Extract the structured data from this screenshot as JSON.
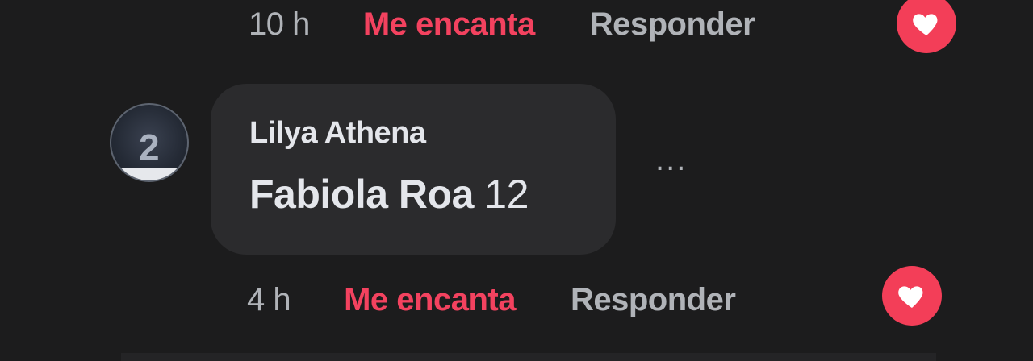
{
  "top_comment": {
    "time": "10 h",
    "love_label": "Me encanta",
    "reply_label": "Responder",
    "reaction_icon": "heart-icon"
  },
  "reply_comment": {
    "author": "Lilya Athena",
    "text_bold": "Fabiola Roa",
    "text_number": "12",
    "more_label": "...",
    "time": "4 h",
    "love_label": "Me encanta",
    "reply_label": "Responder",
    "reaction_icon": "heart-icon"
  },
  "colors": {
    "background": "#1c1c1d",
    "bubble": "#2b2b2d",
    "love_text": "#f3425f",
    "muted_text": "#b0b3b8",
    "primary_text": "#e4e6eb",
    "heart_badge": "#f33e58"
  }
}
